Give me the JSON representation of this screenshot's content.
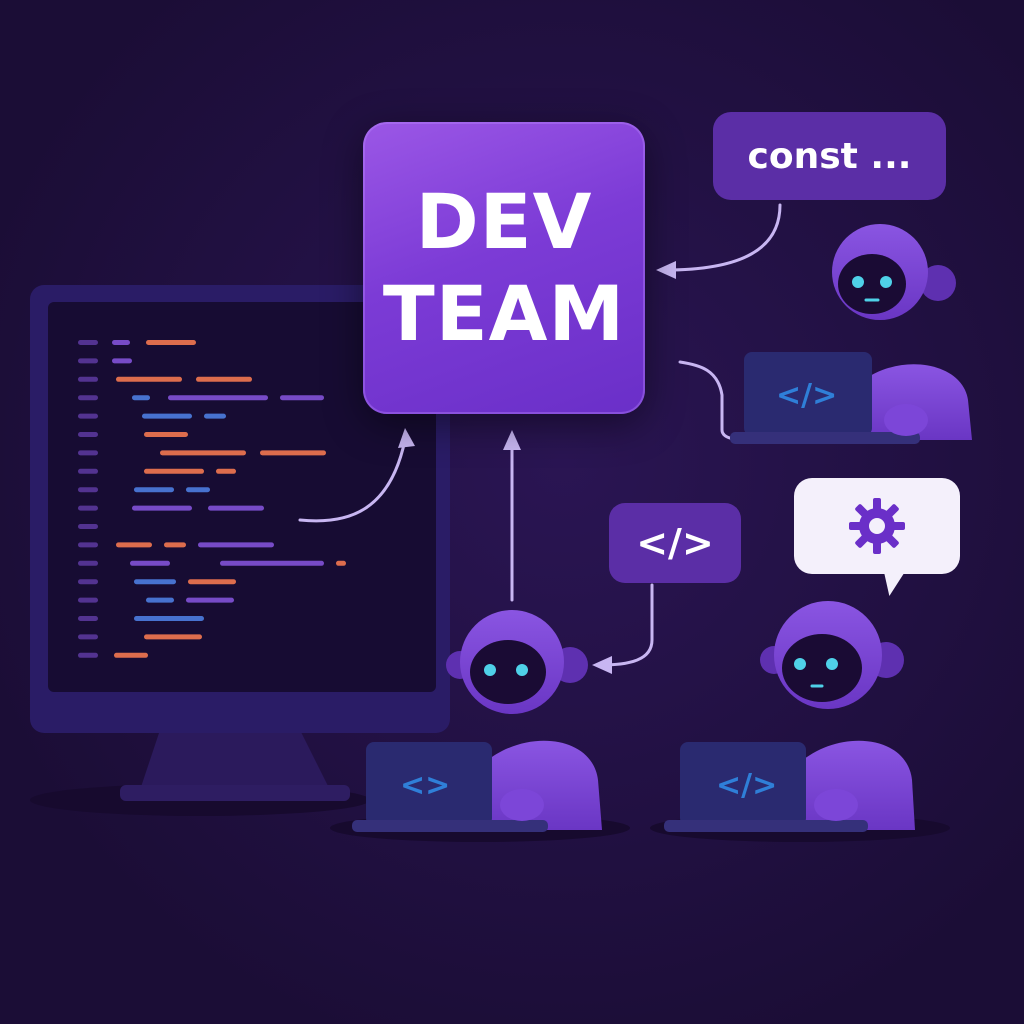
{
  "title": {
    "line1": "DEV",
    "line2": "TEAM"
  },
  "bubbles": {
    "const_text": "const ...",
    "code_tag": "</>",
    "gear": "gear-icon"
  },
  "laptop_glyphs": {
    "top_right": "</>",
    "bottom_left": "<>",
    "bottom_right": "</>"
  },
  "colors": {
    "background": "#1e0f3b",
    "card": "#7c3bd6",
    "robot": "#7b45d6",
    "robot_eye": "#4fd1e8",
    "code_orange": "#e8734f",
    "code_blue": "#4a78d8",
    "code_purple": "#7c4fd0"
  }
}
